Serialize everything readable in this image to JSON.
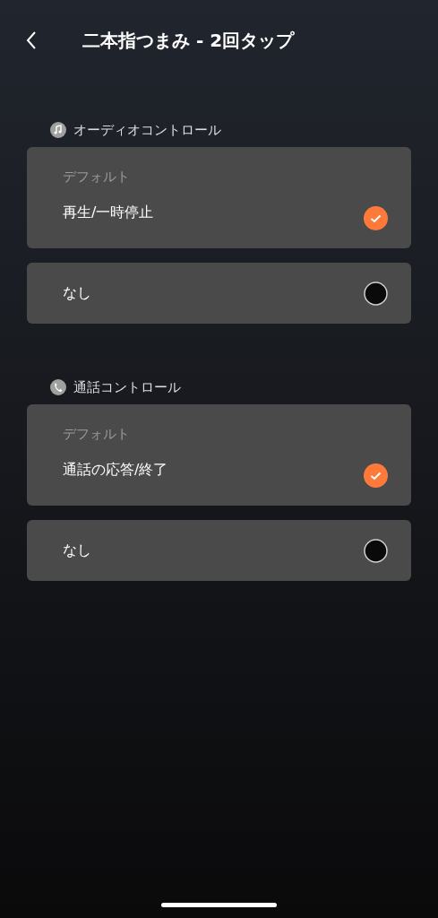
{
  "header": {
    "title": "二本指つまみ - 2回タップ"
  },
  "sections": [
    {
      "kind": "audio",
      "title": "オーディオコントロール",
      "options": [
        {
          "caption": "デフォルト",
          "label": "再生/一時停止",
          "selected": true
        },
        {
          "label": "なし",
          "selected": false
        }
      ]
    },
    {
      "kind": "call",
      "title": "通話コントロール",
      "options": [
        {
          "caption": "デフォルト",
          "label": "通話の応答/終了",
          "selected": true
        },
        {
          "label": "なし",
          "selected": false
        }
      ]
    }
  ]
}
